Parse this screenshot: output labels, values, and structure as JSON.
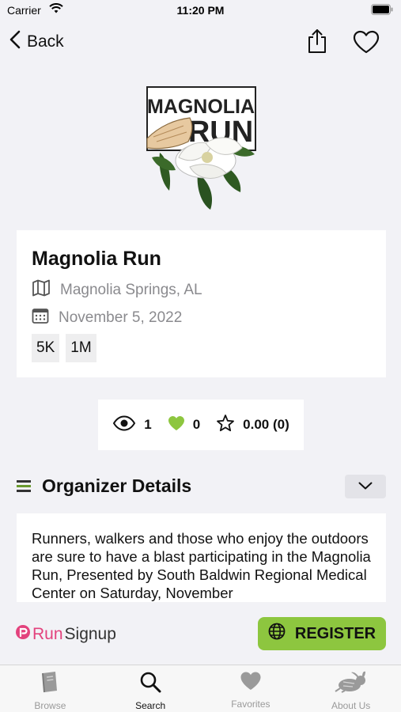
{
  "status_bar": {
    "carrier": "Carrier",
    "time": "11:20 PM"
  },
  "nav": {
    "back_label": "Back"
  },
  "event": {
    "title": "Magnolia Run",
    "location": "Magnolia Springs, AL",
    "date": "November 5, 2022",
    "distances": [
      "5K",
      "1M"
    ],
    "logo_text_line1": "MAGNOLIA",
    "logo_text_line2": "RUN"
  },
  "stats": {
    "views": "1",
    "likes": "0",
    "rating": "0.00 (0)"
  },
  "organizer": {
    "title": "Organizer Details",
    "description": "Runners, walkers and those who enjoy the outdoors are sure to have a blast participating in the Magnolia Run, Presented by South Baldwin Regional Medical Center on Saturday, November"
  },
  "footer": {
    "brand_run": "Run",
    "brand_signup": "Signup",
    "register_label": "REGISTER"
  },
  "tabs": [
    {
      "label": "Browse",
      "icon": "book-icon",
      "active": false
    },
    {
      "label": "Search",
      "icon": "search-icon",
      "active": true
    },
    {
      "label": "Favorites",
      "icon": "heart-icon",
      "active": false
    },
    {
      "label": "About Us",
      "icon": "rabbit-icon",
      "active": false
    }
  ],
  "colors": {
    "accent_green": "#8dc63f",
    "brand_pink": "#e3427d",
    "background": "#f2f2f6"
  }
}
